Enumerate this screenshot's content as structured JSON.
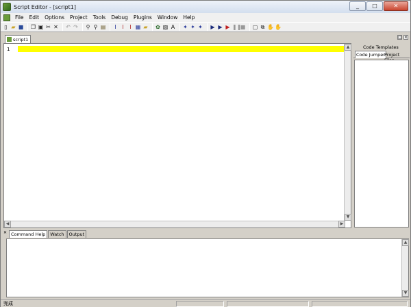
{
  "window": {
    "title": "Script Editor - [script1]"
  },
  "menu": [
    "File",
    "Edit",
    "Options",
    "Project",
    "Tools",
    "Debug",
    "Plugins",
    "Window",
    "Help"
  ],
  "toolbar_icons": [
    "new-icon",
    "open-icon",
    "save-icon",
    "copy-icon",
    "paste-icon",
    "cut-icon",
    "delete-icon",
    "undo-icon",
    "redo-icon",
    "find-icon",
    "find-next-icon",
    "replace-icon",
    "bookmark-icon",
    "bookmark-next-icon",
    "bookmark-prev-icon",
    "bookmark-clear-icon",
    "folder-icon",
    "compile-icon",
    "options-icon",
    "font-icon",
    "run-icon",
    "step-icon",
    "step-over-icon",
    "play-icon",
    "run-to-cursor-icon",
    "breakpoint-icon",
    "pause-icon",
    "stop-icon",
    "window-icon",
    "restore-icon",
    "hand-icon",
    "hand-disabled-icon"
  ],
  "document": {
    "tab_label": "script1",
    "line_number": "1"
  },
  "right_panel": {
    "tab_code_templates": "Code Templates",
    "tab_code_jumper": "Code Jumper",
    "tab_project_files": "Project Files"
  },
  "bottom_panel": {
    "tabs": [
      "Command Help",
      "Watch",
      "Output"
    ]
  },
  "status": {
    "text": "完成"
  },
  "colors": {
    "highlight": "#ffff00"
  }
}
